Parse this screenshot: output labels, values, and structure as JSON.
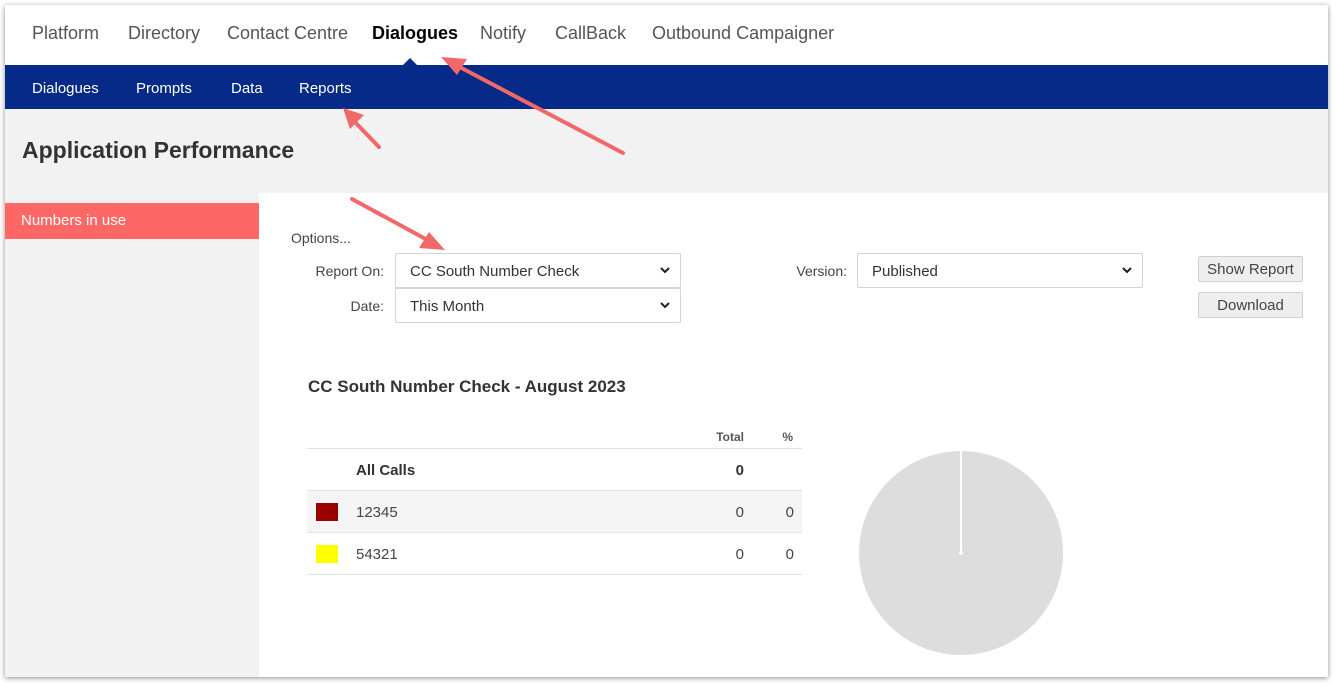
{
  "top_nav": {
    "items": [
      "Platform",
      "Directory",
      "Contact Centre",
      "Dialogues",
      "Notify",
      "CallBack",
      "Outbound Campaigner"
    ],
    "active": "Dialogues"
  },
  "sub_nav": {
    "items": [
      "Dialogues",
      "Prompts",
      "Data",
      "Reports"
    ]
  },
  "page_title": "Application Performance",
  "sidebar": {
    "items": [
      "Numbers in use"
    ]
  },
  "options": {
    "label": "Options...",
    "report_on_label": "Report On:",
    "report_on_value": "CC South Number Check",
    "date_label": "Date:",
    "date_value": "This Month",
    "version_label": "Version:",
    "version_value": "Published",
    "show_report_label": "Show Report",
    "download_label": "Download"
  },
  "report": {
    "title": "CC South Number Check - August 2023",
    "columns": [
      "Total",
      "%"
    ],
    "summary": {
      "name": "All Calls",
      "total": "0"
    },
    "rows": [
      {
        "name": "12345",
        "total": "0",
        "pct": "0",
        "color": "#990000"
      },
      {
        "name": "54321",
        "total": "0",
        "pct": "0",
        "color": "#ffff00"
      }
    ]
  },
  "colors": {
    "nav_blue": "#062a87",
    "sidebar_active": "#fd6866",
    "annotation_arrow": "#f26868",
    "pie_fill": "#dddddd"
  },
  "chart_data": {
    "type": "pie",
    "categories": [
      "12345",
      "54321"
    ],
    "values": [
      0,
      0
    ]
  }
}
